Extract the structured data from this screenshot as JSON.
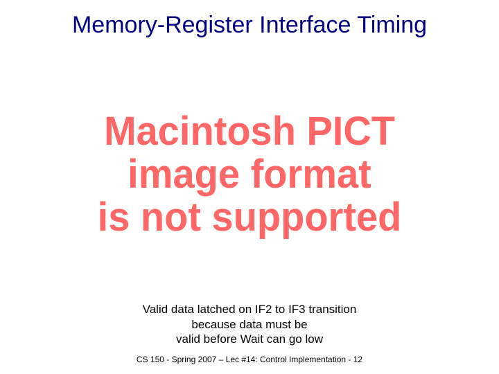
{
  "title": "Memory-Register Interface Timing",
  "pict_line1": "Macintosh PICT",
  "pict_line2": "image format",
  "pict_line3": "is not supported",
  "caption_line1": "Valid data latched on IF2 to IF3 transition",
  "caption_line2": "because data must be",
  "caption_line3": "valid before Wait can go low",
  "footer": "CS 150 - Spring 2007 – Lec #14: Control Implementation - 12"
}
